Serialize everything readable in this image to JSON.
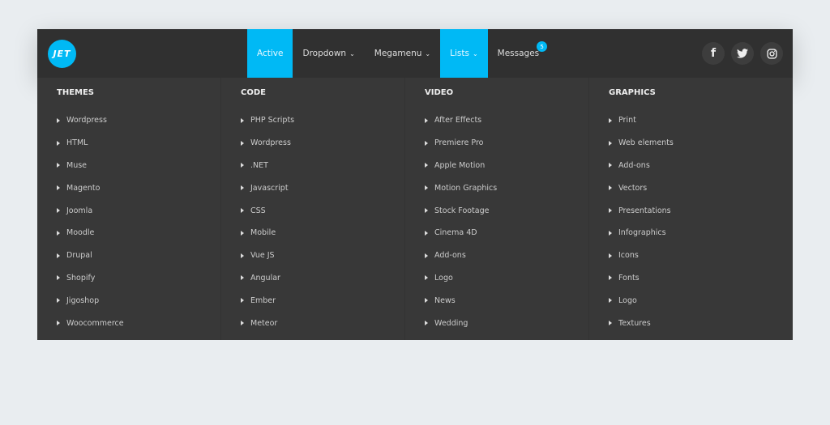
{
  "logo": "JET",
  "menu": [
    {
      "label": "Active",
      "active": true,
      "chevron": false
    },
    {
      "label": "Dropdown",
      "active": false,
      "chevron": true
    },
    {
      "label": "Megamenu",
      "active": false,
      "chevron": true
    },
    {
      "label": "Lists",
      "active": true,
      "chevron": true
    },
    {
      "label": "Messages",
      "active": false,
      "chevron": false,
      "badge": "5"
    }
  ],
  "social": [
    "facebook-icon",
    "twitter-icon",
    "instagram-icon"
  ],
  "columns": [
    {
      "title": "THEMES",
      "items": [
        "Wordpress",
        "HTML",
        "Muse",
        "Magento",
        "Joomla",
        "Moodle",
        "Drupal",
        "Shopify",
        "Jigoshop",
        "Woocommerce"
      ]
    },
    {
      "title": "CODE",
      "items": [
        "PHP Scripts",
        "Wordpress",
        ".NET",
        "Javascript",
        "CSS",
        "Mobile",
        "Vue JS",
        "Angular",
        "Ember",
        "Meteor"
      ]
    },
    {
      "title": "VIDEO",
      "items": [
        "After Effects",
        "Premiere Pro",
        "Apple Motion",
        "Motion Graphics",
        "Stock Footage",
        "Cinema 4D",
        "Add-ons",
        "Logo",
        "News",
        "Wedding"
      ]
    },
    {
      "title": "GRAPHICS",
      "items": [
        "Print",
        "Web elements",
        "Add-ons",
        "Vectors",
        "Presentations",
        "Infographics",
        "Icons",
        "Fonts",
        "Logo",
        "Textures"
      ]
    }
  ],
  "colors": {
    "accent": "#00b9f5",
    "header": "#303030",
    "mega": "#383838"
  }
}
